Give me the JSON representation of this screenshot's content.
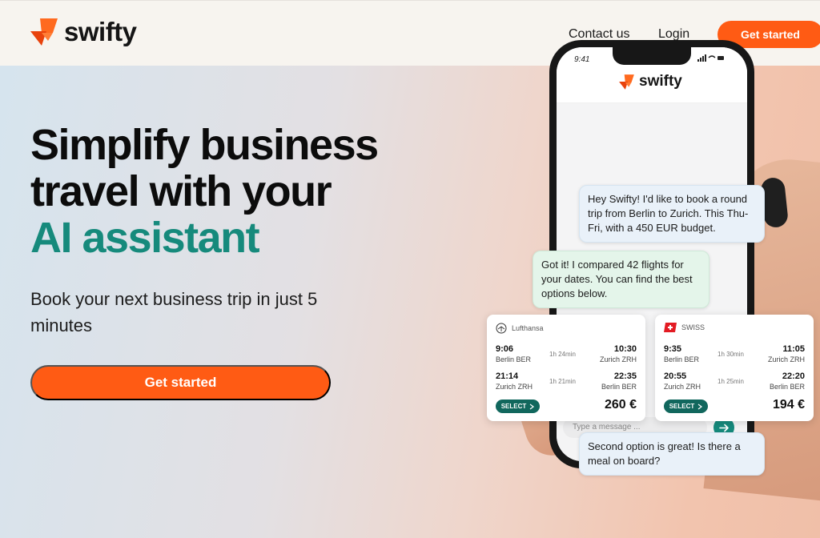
{
  "colors": {
    "brand_orange": "#ff5b14",
    "brand_teal": "#168a7c"
  },
  "header": {
    "brand": "swifty",
    "nav": {
      "contact": "Contact us",
      "login": "Login"
    },
    "cta": "Get started"
  },
  "hero": {
    "title_line1": "Simplify business",
    "title_line2": "travel with your",
    "title_accent": "AI assistant",
    "subtitle": "Book your next business trip in just 5 minutes",
    "cta": "Get started"
  },
  "phone": {
    "time": "9:41",
    "brand": "swifty",
    "input_placeholder": "Type a message ...",
    "messages": {
      "user1": "Hey Swifty! I'd like to book a round trip from Berlin to Zurich. This Thu-Fri, with a 450 EUR budget.",
      "bot1": "Got it! I compared 42 flights for your dates. You can find the best options below.",
      "user2": "Second option is great! Is there a meal on board?"
    }
  },
  "flights": [
    {
      "airline": "Lufthansa",
      "outbound": {
        "dep_time": "9:06",
        "dep_city": "Berlin BER",
        "duration": "1h 24min",
        "arr_time": "10:30",
        "arr_city": "Zurich ZRH"
      },
      "return": {
        "dep_time": "21:14",
        "dep_city": "Zurich ZRH",
        "duration": "1h 21min",
        "arr_time": "22:35",
        "arr_city": "Berlin BER"
      },
      "select": "SELECT",
      "price": "260 €"
    },
    {
      "airline": "SWISS",
      "outbound": {
        "dep_time": "9:35",
        "dep_city": "Berlin BER",
        "duration": "1h 30min",
        "arr_time": "11:05",
        "arr_city": "Zurich ZRH"
      },
      "return": {
        "dep_time": "20:55",
        "dep_city": "Zurich ZRH",
        "duration": "1h 25min",
        "arr_time": "22:20",
        "arr_city": "Berlin BER"
      },
      "select": "SELECT",
      "price": "194 €"
    }
  ]
}
